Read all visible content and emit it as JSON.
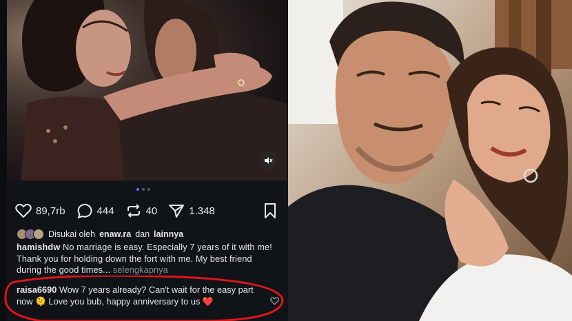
{
  "post": {
    "likes_count": "89,7rb",
    "comments_count": "444",
    "reposts_count": "40",
    "shares_count": "1.348",
    "liked_by_prefix": "Disukai oleh",
    "liked_by_user": "enaw.ra",
    "liked_by_conj": "dan",
    "liked_by_others": "lainnya",
    "caption_user": "hamishdw",
    "caption_text": "No marriage is easy. Especially 7 years of it with me! Thank you for holding down the fort with me. My best friend during the good times...",
    "caption_more": "selengkapnya",
    "comment_user": "raisa6690",
    "comment_text": "Wow 7 years already? Can't wait for the easy part now 🫠 Love you bub, happy anniversary to us ❤️"
  },
  "colors": {
    "highlight_circle": "#e0141b",
    "carousel_active": "#3d8bfd",
    "panel_bg": "#101418"
  },
  "icons": [
    "heart-icon",
    "comment-icon",
    "repost-icon",
    "share-icon",
    "bookmark-icon",
    "mute-icon",
    "like-comment-icon"
  ]
}
